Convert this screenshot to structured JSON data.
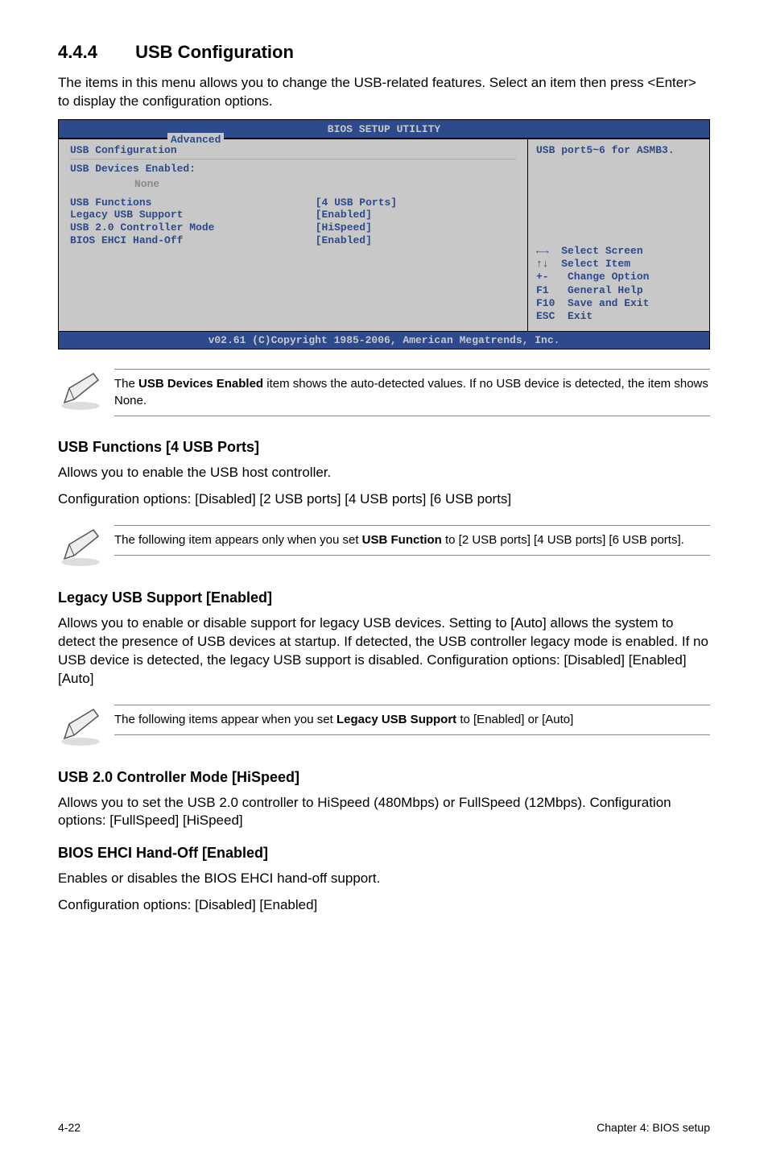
{
  "section": {
    "number": "4.4.4",
    "title": "USB Configuration"
  },
  "intro": "The items in this menu allows you to change the USB-related features. Select an item then press <Enter> to display the configuration options.",
  "bios": {
    "titlebar": "BIOS SETUP UTILITY",
    "tab": "Advanced",
    "left": {
      "header": "USB Configuration",
      "sub": "USB Devices Enabled:",
      "none": "None",
      "rows": [
        {
          "label": "USB Functions",
          "value": "[4 USB Ports]"
        },
        {
          "label": "Legacy USB Support",
          "value": "[Enabled]"
        },
        {
          "label": "USB 2.0 Controller Mode",
          "value": "[HiSpeed]"
        },
        {
          "label": "BIOS EHCI Hand-Off",
          "value": "[Enabled]"
        }
      ]
    },
    "right": {
      "hint": "USB port5~6 for ASMB3.",
      "nav": "←→  Select Screen\n↑↓  Select Item\n+-   Change Option\nF1   General Help\nF10  Save and Exit\nESC  Exit"
    },
    "footer": "v02.61 (C)Copyright 1985-2006, American Megatrends, Inc."
  },
  "note1": {
    "text_a": "The ",
    "bold": "USB Devices Enabled",
    "text_b": " item shows the auto-detected values. If no USB device is detected, the item shows None."
  },
  "usb_functions": {
    "heading": "USB Functions [4 USB Ports]",
    "p1": "Allows you to enable the USB host controller.",
    "p2": "Configuration options: [Disabled] [2 USB ports] [4 USB ports] [6 USB ports]"
  },
  "note2": {
    "text_a": "The following item appears only when you set ",
    "bold": "USB Function",
    "text_b": " to [2 USB ports] [4 USB ports] [6 USB ports]."
  },
  "legacy": {
    "heading": "Legacy USB Support [Enabled]",
    "p": "Allows you to enable or disable support for legacy USB devices. Setting to [Auto] allows the system to detect the presence of USB devices at startup. If detected, the USB controller legacy mode is enabled. If no USB device is detected, the legacy USB support is disabled. Configuration options: [Disabled] [Enabled] [Auto]"
  },
  "note3": {
    "text_a": "The following items appear when you set ",
    "bold": "Legacy USB Support",
    "text_b": " to [Enabled] or [Auto]"
  },
  "usb20": {
    "heading": "USB 2.0 Controller Mode [HiSpeed]",
    "p": "Allows you to set the USB 2.0 controller to HiSpeed (480Mbps) or FullSpeed (12Mbps). Configuration options: [FullSpeed] [HiSpeed]"
  },
  "ehci": {
    "heading": "BIOS EHCI Hand-Off [Enabled]",
    "p1": "Enables or disables the BIOS EHCI hand-off support.",
    "p2": "Configuration options: [Disabled] [Enabled]"
  },
  "footer": {
    "page": "4-22",
    "chapter": "Chapter 4: BIOS setup"
  }
}
